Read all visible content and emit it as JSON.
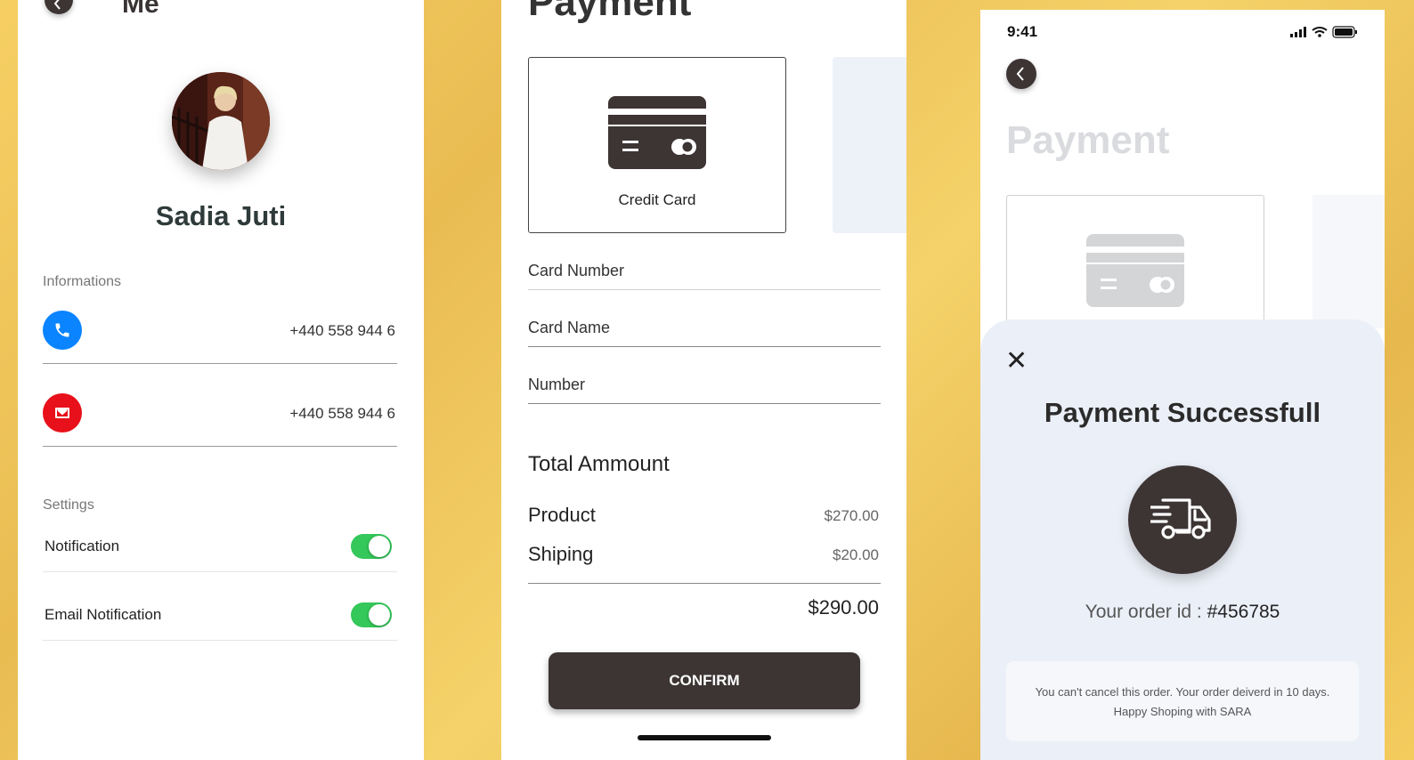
{
  "profile": {
    "title": "Me",
    "name": "Sadia Juti",
    "informations_label": "Informations",
    "phone": "+440 558 944 6",
    "email": "+440 558 944 6",
    "settings_label": "Settings",
    "settings": [
      {
        "label": "Notification",
        "enabled": true
      },
      {
        "label": "Email Notification",
        "enabled": true
      }
    ],
    "colors": {
      "phone": "#0a84ff",
      "email": "#e8101a",
      "toggle_on": "#34c759"
    }
  },
  "payment": {
    "title": "Payment",
    "method_label": "Credit Card",
    "fields": {
      "card_number": "Card Number",
      "card_name": "Card Name",
      "number": "Number"
    },
    "total_heading": "Total Ammount",
    "lines": [
      {
        "label": "Product",
        "amount": "$270.00"
      },
      {
        "label": "Shiping",
        "amount": "$20.00"
      }
    ],
    "total": "$290.00",
    "confirm_label": "CONFIRM",
    "colors": {
      "primary": "#3d3434"
    }
  },
  "success": {
    "time": "9:41",
    "title": "Payment",
    "close_symbol": "✕",
    "heading": "Payment Successfull",
    "order_prefix": "Your order id :",
    "order_id": "#456785",
    "note": "You can't cancel this order. Your order deiverd in 10 days. Happy Shoping with SARA"
  }
}
